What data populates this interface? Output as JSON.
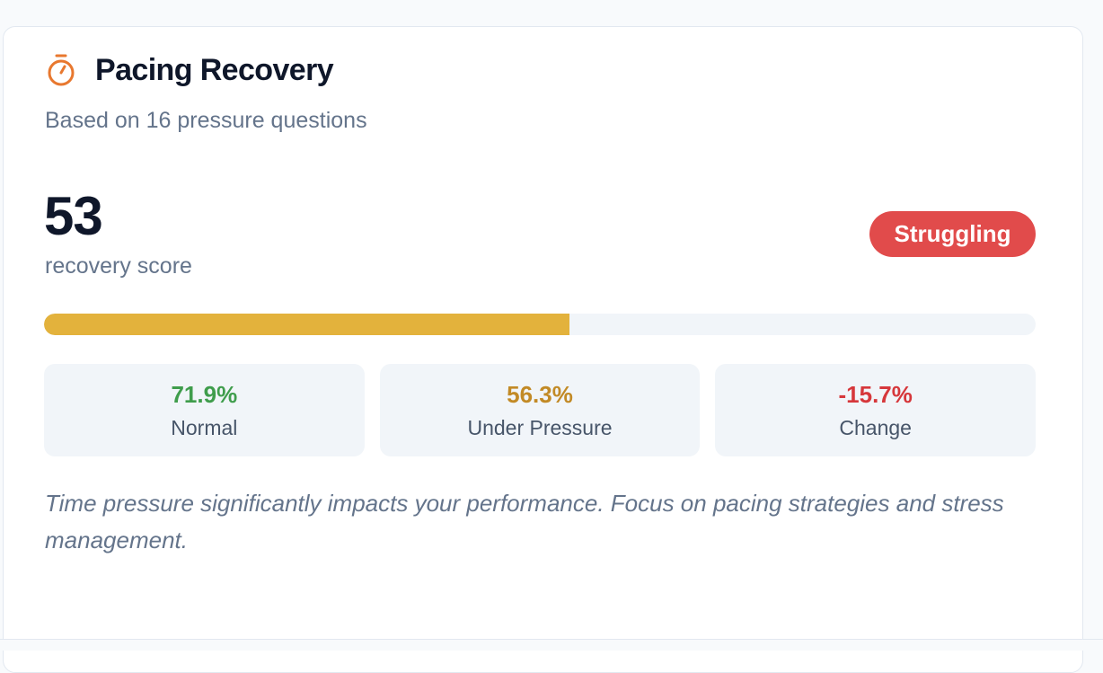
{
  "card": {
    "title": "Pacing Recovery",
    "icon": "stopwatch-icon",
    "subtitle": "Based on 16 pressure questions",
    "score": {
      "value": "53",
      "label": "recovery score",
      "progress_percent": 53
    },
    "badge": {
      "label": "Struggling",
      "color": "#e14b4b"
    },
    "stats": [
      {
        "value": "71.9%",
        "label": "Normal",
        "color": "#3f9d4c"
      },
      {
        "value": "56.3%",
        "label": "Under Pressure",
        "color": "#c28a26"
      },
      {
        "value": "-15.7%",
        "label": "Change",
        "color": "#d6373b"
      }
    ],
    "note": "Time pressure significantly impacts your performance. Focus on pacing strategies and stress management."
  },
  "colors": {
    "accent_icon": "#e8782f",
    "progress_fill": "#e3b23c",
    "progress_track": "#f1f5f9"
  }
}
